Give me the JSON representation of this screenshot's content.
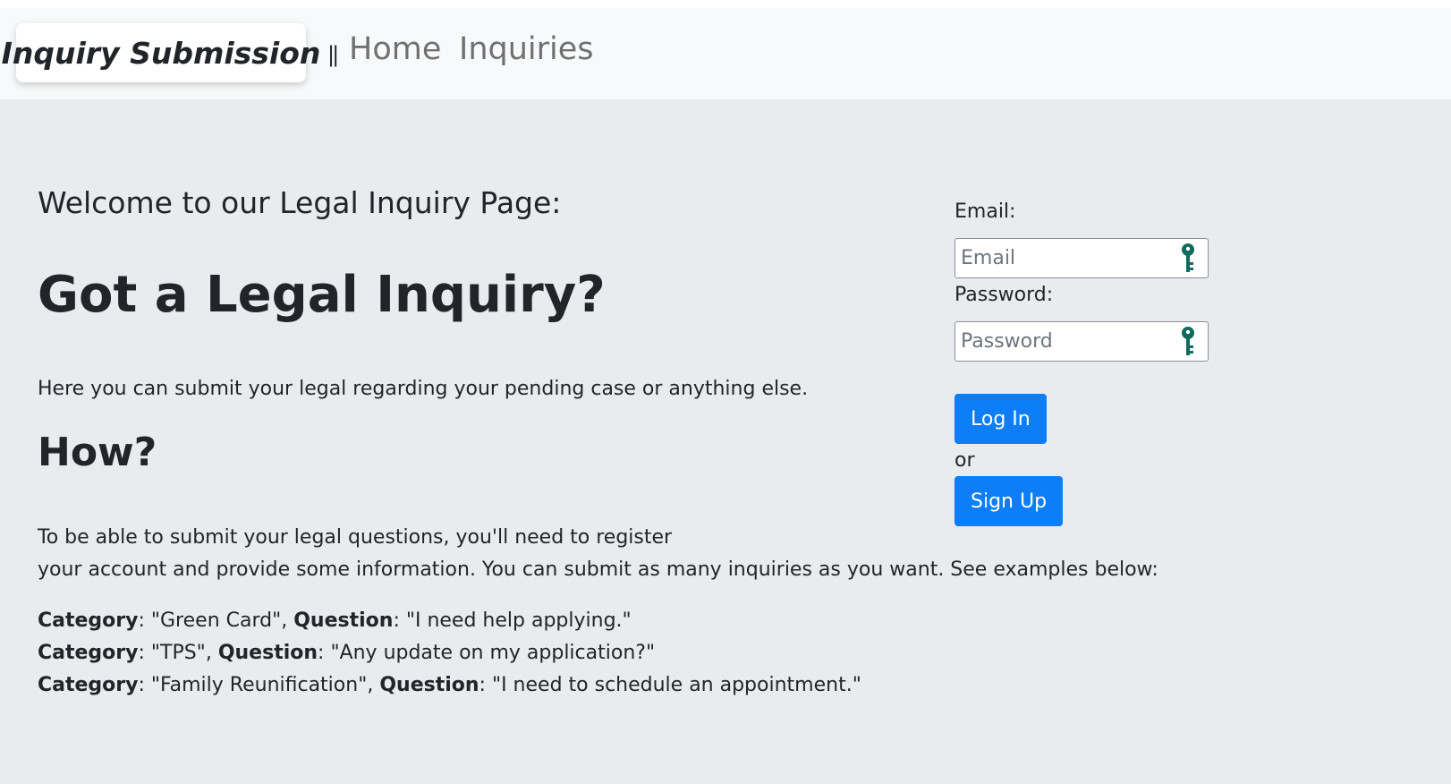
{
  "navbar": {
    "brand": "Inquiry Submission",
    "separator": "||",
    "links": [
      {
        "label": "Home"
      },
      {
        "label": "Inquiries"
      }
    ]
  },
  "main": {
    "welcome": "Welcome to our Legal Inquiry Page:",
    "title": "Got a Legal Inquiry?",
    "intro": "Here you can submit your legal regarding your pending case or anything else.",
    "how_heading": "How?",
    "instructions_line1": "To be able to submit your legal questions, you'll need to register",
    "instructions_line2": "your account and provide some information. You can submit as many inquiries as you want. See examples below:",
    "category_label": "Category",
    "question_label": "Question",
    "examples": [
      {
        "category": "\"Green Card\"",
        "question": "\"I need help applying.\""
      },
      {
        "category": "\"TPS\"",
        "question": "\"Any update on my application?\""
      },
      {
        "category": "\"Family Reunification\"",
        "question": "\"I need to schedule an appointment.\""
      }
    ]
  },
  "login": {
    "email_label": "Email:",
    "email_placeholder": "Email",
    "email_value": "",
    "password_label": "Password:",
    "password_placeholder": "Password",
    "password_value": "",
    "login_button": "Log In",
    "or_text": "or",
    "signup_button": "Sign Up",
    "field_icon": "key-icon"
  },
  "colors": {
    "navbar_bg": "#f8f9fa",
    "page_bg": "#e9ecef",
    "primary_button": "#0d7ef8",
    "key_icon": "#0f6b5c",
    "nav_link": "#7d7f82"
  }
}
